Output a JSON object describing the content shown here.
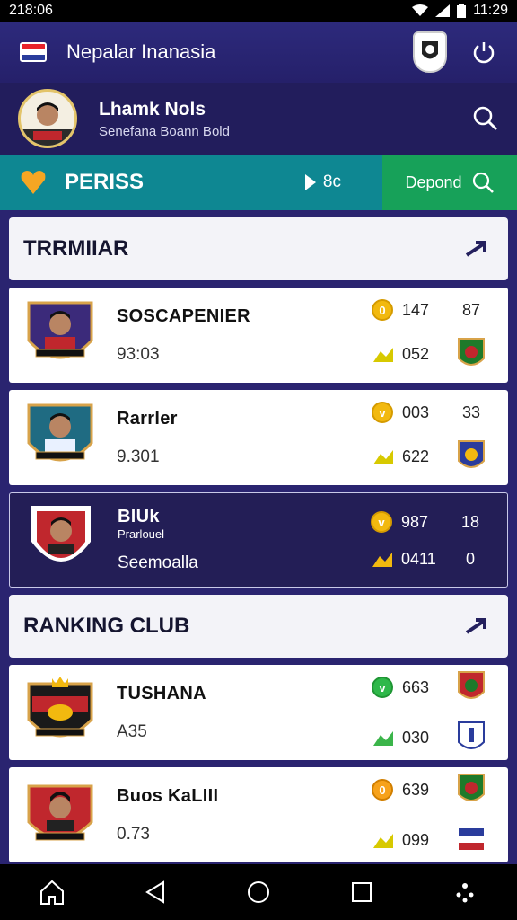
{
  "status": {
    "time": "218:06",
    "clock": "11:29"
  },
  "header": {
    "title": "Nepalar Inanasia",
    "flag_colors": [
      "#e8232a",
      "#ffffff",
      "#2a3c9c"
    ]
  },
  "profile": {
    "name": "Lhamk Nols",
    "subtitle": "Senefana Boann Bold"
  },
  "promo": {
    "title": "PERISS",
    "play_count": "8c",
    "deposit_label": "Depond"
  },
  "sections": [
    {
      "title": "TRRMIIAR",
      "cards": [
        {
          "name": "SOSCAPENIER",
          "sub": "",
          "meta": "93:03",
          "stat1": "147",
          "stat1_right": "87",
          "stat2": "052",
          "coin_label": "0",
          "coin": "yellow",
          "active": false
        },
        {
          "name": "Rarrler",
          "sub": "",
          "meta": "9.301",
          "stat1": "003",
          "stat1_right": "33",
          "stat2": "622",
          "coin_label": "v",
          "coin": "yellow",
          "active": false
        },
        {
          "name": "BlUk",
          "sub": "Prarlouel",
          "meta": "Seemoalla",
          "stat1": "987",
          "stat1_right": "18",
          "stat2": "0411",
          "stat2_right": "0",
          "coin_label": "v",
          "coin": "yellow",
          "active": true
        }
      ]
    },
    {
      "title": "RANKING CLUB",
      "cards": [
        {
          "name": "TUSHANA",
          "sub": "",
          "meta": "A35",
          "stat1": "663",
          "stat2": "030",
          "coin_label": "v",
          "coin": "green",
          "active": false
        },
        {
          "name": "Buos KaLIII",
          "sub": "",
          "meta": "0.73",
          "stat1": "639",
          "stat2": "099",
          "coin_label": "0",
          "coin": "orange",
          "active": false
        }
      ]
    }
  ]
}
